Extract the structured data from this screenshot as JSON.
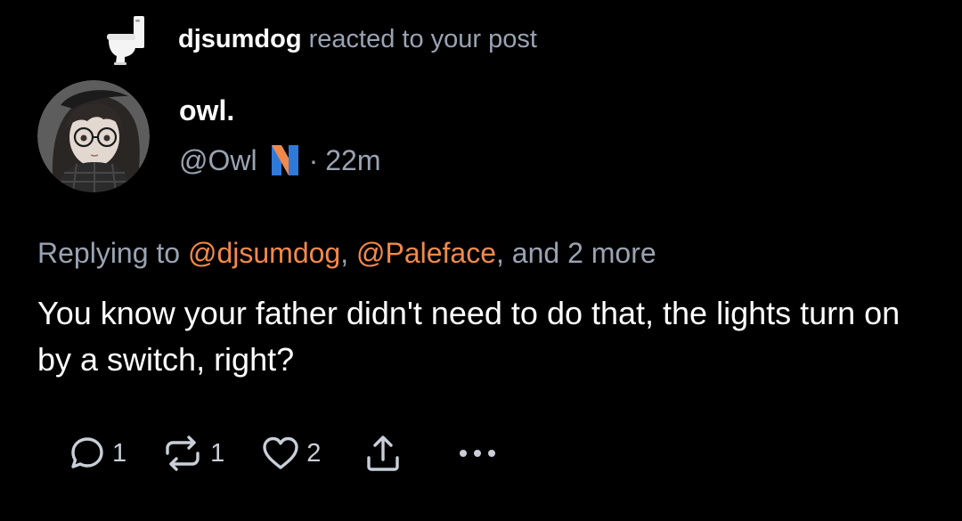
{
  "notification": {
    "reactor_name": "djsumdog",
    "action_text": "reacted to your post",
    "reaction_icon": "toilet-icon"
  },
  "post": {
    "author": {
      "display_name": "owl.",
      "handle": "@Owl",
      "separator": "·",
      "time_ago": "22m",
      "badge_icon": "instance-badge-icon"
    },
    "reply_prefix": "Replying to",
    "mentions": [
      "@djsumdog",
      "@Paleface"
    ],
    "reply_sep": ",",
    "reply_and": ", and 2 more",
    "content": "You know your father didn't need to do that, the lights turn on by a switch, right?",
    "actions": {
      "replies": "1",
      "reposts": "1",
      "likes": "2"
    }
  },
  "colors": {
    "background": "#000000",
    "muted_text": "#9aa3b2",
    "mention": "#f2894a",
    "icon": "#c9cfd8"
  }
}
